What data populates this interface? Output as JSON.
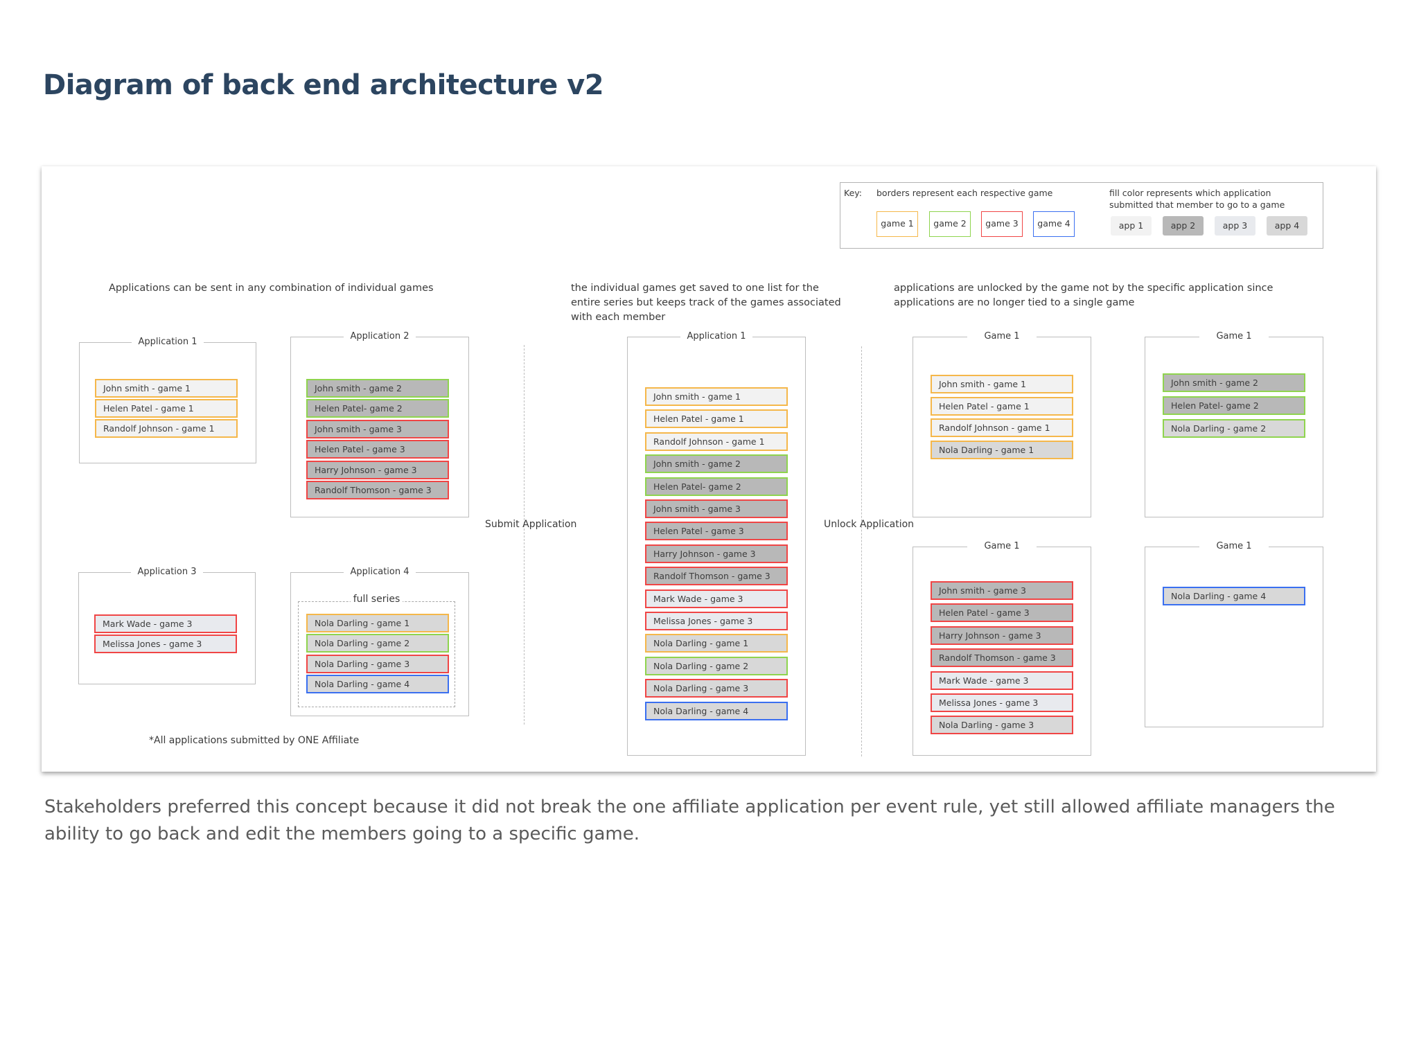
{
  "page": {
    "title": "Diagram of back end architecture v2",
    "paragraph": "Stakeholders preferred this concept because it did not break the one affiliate application per event rule, yet still allowed affiliate managers the ability to go back and edit the members going to a specific game."
  },
  "colors": {
    "title": "#2c4560",
    "game_borders": {
      "game1": "#f5b74a",
      "game2": "#8fd44e",
      "game3": "#f04545",
      "game4": "#3a6ff0"
    },
    "app_fills": {
      "app1": "#f2f2f2",
      "app2": "#b8b8b8",
      "app3": "#e8eaee",
      "app4": "#d8d8d8"
    }
  },
  "key": {
    "label": "Key:",
    "borders_text": "borders represent each respective game",
    "fill_text_line1": "fill color represents which application",
    "fill_text_line2": "submitted that member to go to a game",
    "games": [
      "game 1",
      "game 2",
      "game 3",
      "game 4"
    ],
    "apps": [
      "app 1",
      "app 2",
      "app 3",
      "app 4"
    ]
  },
  "captions": {
    "left": "Applications can be sent in any combination of individual games",
    "middle_line1": "the individual games get saved to one list for the",
    "middle_line2": "entire series but keeps track of the games associated",
    "middle_line3": "with each member",
    "right_line1": "applications are unlocked by the game not by the specific application since",
    "right_line2": "applications are no longer tied to a single game"
  },
  "flow": {
    "submit": "Submit Application",
    "unlock": "Unlock Application"
  },
  "note": "*All applications submitted by  ONE Affiliate",
  "left_apps": [
    {
      "label": "Application 1",
      "items": [
        {
          "text": "John smith - game 1",
          "game": 1,
          "app": 1
        },
        {
          "text": "Helen Patel - game 1",
          "game": 1,
          "app": 1
        },
        {
          "text": "Randolf Johnson - game 1",
          "game": 1,
          "app": 1
        }
      ]
    },
    {
      "label": "Application 2",
      "items": [
        {
          "text": "John smith - game 2",
          "game": 2,
          "app": 2
        },
        {
          "text": "Helen Patel- game 2",
          "game": 2,
          "app": 2
        },
        {
          "text": "John smith - game 3",
          "game": 3,
          "app": 2
        },
        {
          "text": "Helen Patel - game 3",
          "game": 3,
          "app": 2
        },
        {
          "text": "Harry Johnson - game 3",
          "game": 3,
          "app": 2
        },
        {
          "text": "Randolf Thomson - game 3",
          "game": 3,
          "app": 2
        }
      ]
    },
    {
      "label": "Application 3",
      "items": [
        {
          "text": "Mark Wade - game 3",
          "game": 3,
          "app": 3
        },
        {
          "text": "Melissa Jones - game 3",
          "game": 3,
          "app": 3
        }
      ]
    },
    {
      "label": "Application 4",
      "series_label": "full series",
      "items": [
        {
          "text": "Nola Darling - game 1",
          "game": 1,
          "app": 4
        },
        {
          "text": "Nola Darling - game 2",
          "game": 2,
          "app": 4
        },
        {
          "text": "Nola Darling - game 3",
          "game": 3,
          "app": 4
        },
        {
          "text": "Nola Darling - game 4",
          "game": 4,
          "app": 4
        }
      ]
    }
  ],
  "combined_app": {
    "label": "Application 1",
    "items": [
      {
        "text": "John smith - game 1",
        "game": 1,
        "app": 1
      },
      {
        "text": "Helen Patel - game 1",
        "game": 1,
        "app": 1
      },
      {
        "text": "Randolf Johnson - game 1",
        "game": 1,
        "app": 1
      },
      {
        "text": "John smith - game 2",
        "game": 2,
        "app": 2
      },
      {
        "text": "Helen Patel- game 2",
        "game": 2,
        "app": 2
      },
      {
        "text": "John smith - game 3",
        "game": 3,
        "app": 2
      },
      {
        "text": "Helen Patel - game 3",
        "game": 3,
        "app": 2
      },
      {
        "text": "Harry Johnson - game 3",
        "game": 3,
        "app": 2
      },
      {
        "text": "Randolf Thomson - game 3",
        "game": 3,
        "app": 2
      },
      {
        "text": "Mark Wade - game 3",
        "game": 3,
        "app": 3
      },
      {
        "text": "Melissa Jones - game 3",
        "game": 3,
        "app": 3
      },
      {
        "text": "Nola Darling - game 1",
        "game": 1,
        "app": 4
      },
      {
        "text": "Nola Darling - game 2",
        "game": 2,
        "app": 4
      },
      {
        "text": "Nola Darling - game 3",
        "game": 3,
        "app": 4
      },
      {
        "text": "Nola Darling - game 4",
        "game": 4,
        "app": 4
      }
    ]
  },
  "game_groups": [
    {
      "label": "Game 1",
      "items": [
        {
          "text": "John smith - game 1",
          "game": 1,
          "app": 1
        },
        {
          "text": "Helen Patel - game 1",
          "game": 1,
          "app": 1
        },
        {
          "text": "Randolf Johnson - game 1",
          "game": 1,
          "app": 1
        },
        {
          "text": "Nola Darling - game 1",
          "game": 1,
          "app": 4
        }
      ]
    },
    {
      "label": "Game 1",
      "items": [
        {
          "text": "John smith - game 2",
          "game": 2,
          "app": 2
        },
        {
          "text": "Helen Patel- game 2",
          "game": 2,
          "app": 2
        },
        {
          "text": "Nola Darling - game 2",
          "game": 2,
          "app": 4
        }
      ]
    },
    {
      "label": "Game 1",
      "items": [
        {
          "text": "John smith - game 3",
          "game": 3,
          "app": 2
        },
        {
          "text": "Helen Patel - game 3",
          "game": 3,
          "app": 2
        },
        {
          "text": "Harry Johnson - game 3",
          "game": 3,
          "app": 2
        },
        {
          "text": "Randolf Thomson - game 3",
          "game": 3,
          "app": 2
        },
        {
          "text": "Mark Wade - game 3",
          "game": 3,
          "app": 3
        },
        {
          "text": "Melissa Jones - game 3",
          "game": 3,
          "app": 3
        },
        {
          "text": "Nola Darling - game 3",
          "game": 3,
          "app": 4
        }
      ]
    },
    {
      "label": "Game 1",
      "items": [
        {
          "text": "Nola Darling - game 4",
          "game": 4,
          "app": 4
        }
      ]
    }
  ]
}
